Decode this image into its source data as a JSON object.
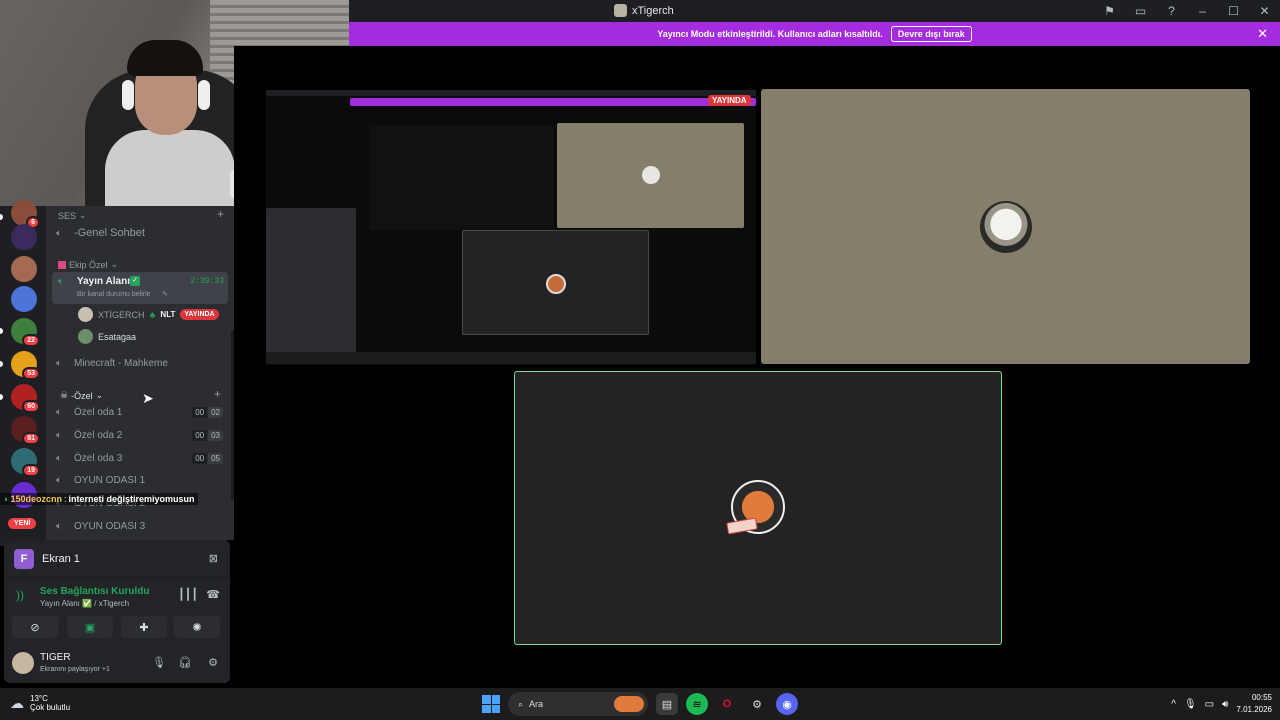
{
  "window": {
    "title": "xTigerch"
  },
  "banner": {
    "text": "Yayıncı Modu etkinleştirildi. Kullanıcı adları kısaltıldı.",
    "button": "Devre dışı bırak"
  },
  "servers": {
    "badges": [
      "6",
      "22",
      "53",
      "60",
      "81",
      "19"
    ],
    "new_label": "YENİ"
  },
  "channels": {
    "ses_category": "SES",
    "genel": "-Genel Sohbet",
    "ekip_category": "Ekip Özel",
    "yayin": {
      "name": "Yayın Alanı",
      "timer": "2:39:33",
      "status": "Bir kanal durumu belirle"
    },
    "users": [
      {
        "name": "XTİGERCH",
        "tag": "NLT",
        "live": "YAYINDA"
      },
      {
        "name": "Esatagaa"
      }
    ],
    "minecraft": "Minecraft - Mahkeme",
    "ozel_category": "-Özel",
    "rooms": [
      {
        "name": "Özel oda 1",
        "a": "00",
        "b": "02"
      },
      {
        "name": "Özel oda 2",
        "a": "00",
        "b": "03"
      },
      {
        "name": "Özel oda 3",
        "a": "00",
        "b": "05"
      }
    ],
    "oyun1": "OYUN ODASI 1",
    "oyun2": "OYUN ODASI 2",
    "oyun3": "OYUN ODASI 3"
  },
  "chat": {
    "user": "150deozcnn",
    "message": "interneti değiştiremiyomusun"
  },
  "stream": {
    "label": "Ekran 1",
    "icon_letter": "F"
  },
  "voice": {
    "title": "Ses Bağlantısı Kuruldu",
    "subtitle": "Yayın Alanı ✅ / xTigerch"
  },
  "me": {
    "name": "TIGER",
    "status": "Ekranını paylaşıyor +1"
  },
  "stage": {
    "live_badge": "YAYINDA"
  },
  "taskbar": {
    "temp": "13°C",
    "condition": "Çok bulutlu",
    "search": "Ara",
    "time": "00:55",
    "date": "7.01.2026"
  },
  "colors": {
    "banner": "#a42be0",
    "accent_green": "#23a55a",
    "live_red": "#da373c",
    "highlight": "#7ddc93"
  }
}
